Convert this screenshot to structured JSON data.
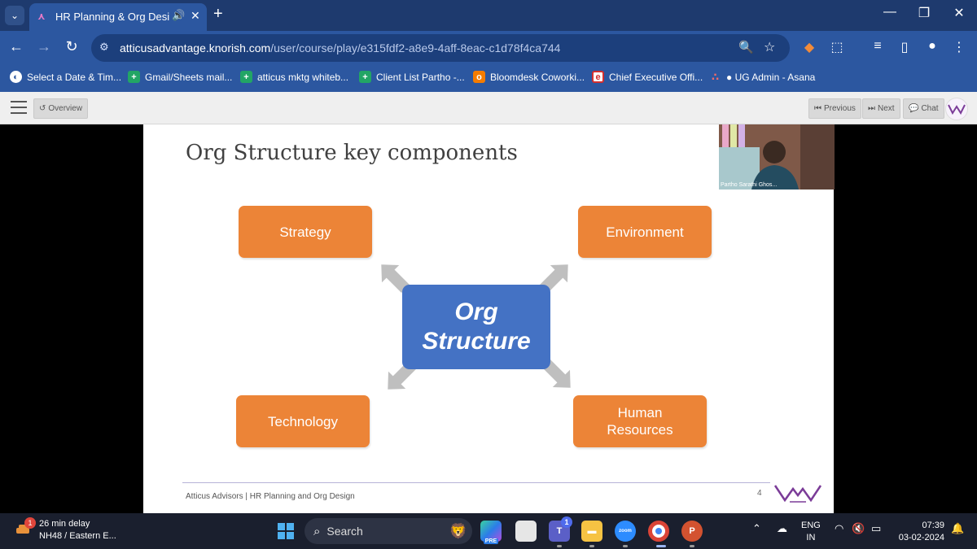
{
  "browser": {
    "tab": {
      "title": "HR Planning & Org Design"
    },
    "url": {
      "host": "atticusadvantage.knorish.com",
      "path": "/user/course/play/e315fdf2-a8e9-4aff-8eac-c1d78f4ca744"
    },
    "bookmarks": [
      {
        "label": "Select a Date & Tim...",
        "icon": "globe-icon",
        "color": "#ffffff"
      },
      {
        "label": "Gmail/Sheets mail...",
        "icon": "sheets-icon",
        "color": "#22a565"
      },
      {
        "label": "atticus mktg whiteb...",
        "icon": "sheets-icon",
        "color": "#22a565"
      },
      {
        "label": "Client List Partho -...",
        "icon": "sheets-icon",
        "color": "#22a565"
      },
      {
        "label": "Bloomdesk Coworki...",
        "icon": "bloomdesk-icon",
        "color": "#f57c00"
      },
      {
        "label": "Chief Executive Offi...",
        "icon": "e-icon",
        "color": "#d32f2f"
      },
      {
        "label": "● UG Admin - Asana",
        "icon": "asana-icon",
        "color": "#f06a6a"
      }
    ]
  },
  "appbar": {
    "overview_label": "Overview",
    "previous_label": "Previous",
    "next_label": "Next",
    "chat_label": "Chat"
  },
  "slide": {
    "title": "Org Structure key components",
    "center_line1": "Org",
    "center_line2": "Structure",
    "boxes": {
      "strategy": "Strategy",
      "environment": "Environment",
      "technology": "Technology",
      "human_line1": "Human",
      "human_line2": "Resources"
    },
    "footer": "Atticus Advisors | HR Planning and Org Design",
    "page_number": "4",
    "colors": {
      "orange": "#ec8437",
      "blue": "#4472c4",
      "arrow_gray": "#bfbfbf"
    }
  },
  "webcam": {
    "name": "Partho Sarathi Ghos..."
  },
  "taskbar": {
    "weather_line1": "26 min delay",
    "weather_line2": "NH48 / Eastern E...",
    "weather_badge": "1",
    "search_label": "Search",
    "teams_badge": "1",
    "lang_line1": "ENG",
    "lang_line2": "IN",
    "time": "07:39",
    "date": "03-02-2024"
  }
}
